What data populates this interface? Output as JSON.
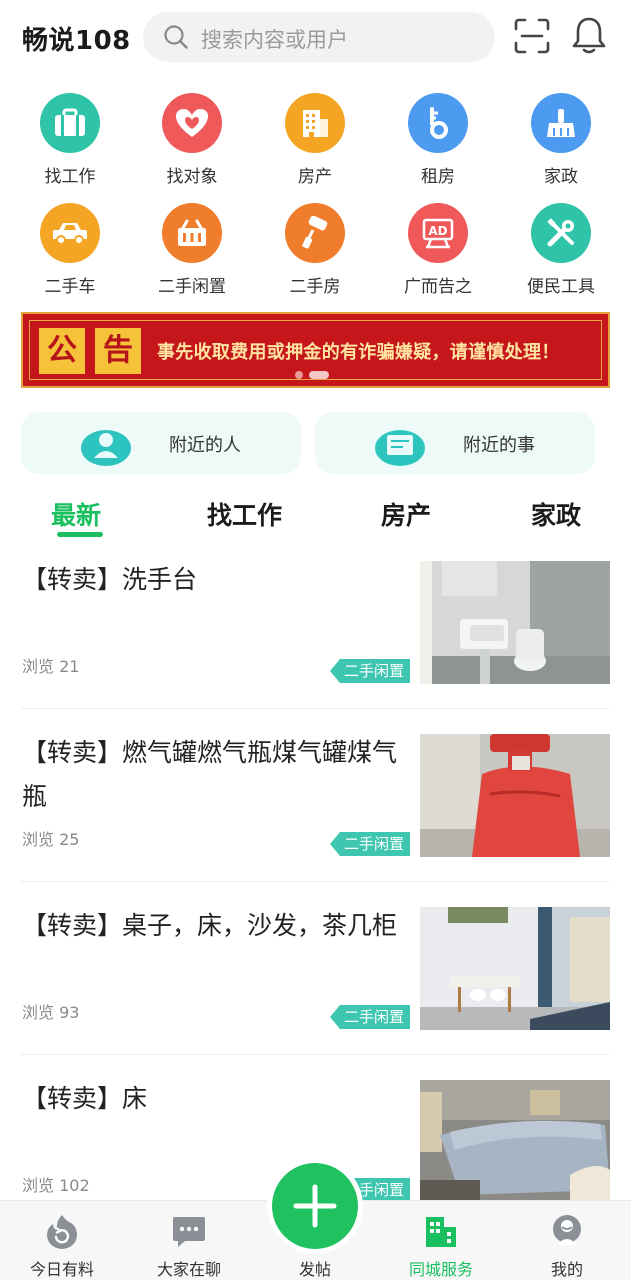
{
  "header": {
    "app_title": "畅说108",
    "search_placeholder": "搜索内容或用户"
  },
  "categories": [
    {
      "label": "找工作",
      "icon": "briefcase-icon",
      "color": "#2fc4a8"
    },
    {
      "label": "找对象",
      "icon": "hearts-icon",
      "color": "#f0595a"
    },
    {
      "label": "房产",
      "icon": "building-icon",
      "color": "#f5a524"
    },
    {
      "label": "租房",
      "icon": "key-icon",
      "color": "#4d9bf0"
    },
    {
      "label": "家政",
      "icon": "broom-icon",
      "color": "#4d9bf0"
    },
    {
      "label": "二手车",
      "icon": "car-icon",
      "color": "#f5a524"
    },
    {
      "label": "二手闲置",
      "icon": "basket-icon",
      "color": "#f07d2b"
    },
    {
      "label": "二手房",
      "icon": "paint-roller-icon",
      "color": "#f07d2b"
    },
    {
      "label": "广而告之",
      "icon": "ad-board-icon",
      "color": "#f0595a"
    },
    {
      "label": "便民工具",
      "icon": "tools-icon",
      "color": "#2fc4a8"
    }
  ],
  "notice": {
    "char1": "公",
    "char2": "告",
    "text": "事先收取费用或押金的有诈骗嫌疑，请谨慎处理！"
  },
  "nearby": {
    "people_label": "附近的人",
    "events_label": "附近的事"
  },
  "tabs": [
    "最新",
    "找工作",
    "房产",
    "家政"
  ],
  "feed": [
    {
      "title": "【转卖】洗手台",
      "views": "浏览 21",
      "tag": "二手闲置"
    },
    {
      "title": "【转卖】燃气罐燃气瓶煤气罐煤气瓶",
      "views": "浏览 25",
      "tag": "二手闲置"
    },
    {
      "title": "【转卖】桌子，床，沙发，茶几柜",
      "views": "浏览 93",
      "tag": "二手闲置"
    },
    {
      "title": "【转卖】床",
      "views": "浏览 102",
      "tag": "二手闲置"
    }
  ],
  "bottom_nav": [
    {
      "label": "今日有料",
      "icon": "flame-refresh-icon"
    },
    {
      "label": "大家在聊",
      "icon": "chat-bubble-icon"
    },
    {
      "label": "发帖",
      "icon": "plus-icon"
    },
    {
      "label": "同城服务",
      "icon": "city-buildings-icon"
    },
    {
      "label": "我的",
      "icon": "profile-icon"
    }
  ],
  "colors": {
    "accent": "#1ac060",
    "tag": "#3fc6b1",
    "notice_bg": "#c5161b"
  }
}
